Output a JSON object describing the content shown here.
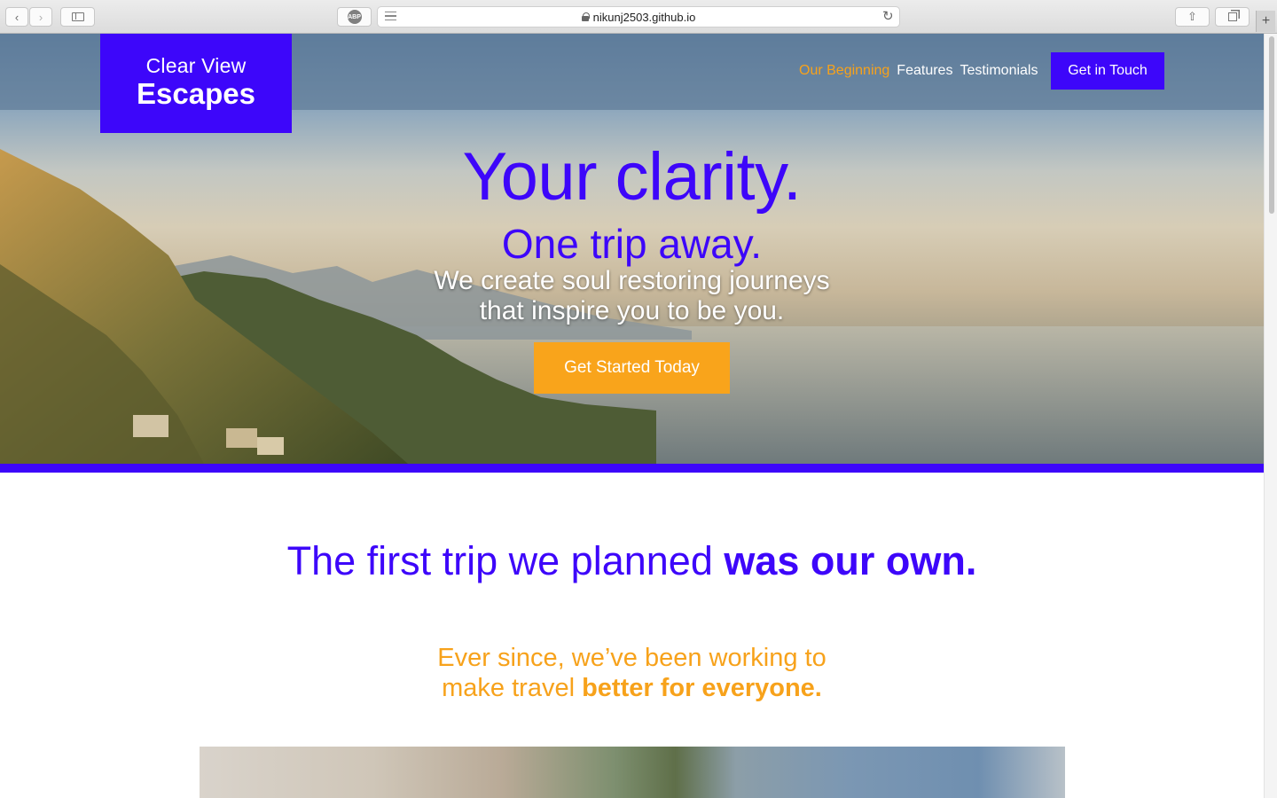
{
  "browser": {
    "url": "nikunj2503.github.io",
    "adblock_label": "ABP"
  },
  "brand": {
    "line1": "Clear View",
    "line2": "Escapes"
  },
  "nav": {
    "items": [
      {
        "label": "Our Beginning",
        "active": true
      },
      {
        "label": "Features",
        "active": false
      },
      {
        "label": "Testimonials",
        "active": false
      }
    ],
    "cta_label": "Get in Touch"
  },
  "hero": {
    "title": "Your clarity.",
    "subtitle": "One trip away.",
    "tagline_line1": "We create soul restoring journeys",
    "tagline_line2": "that inspire you to be you.",
    "button_label": "Get Started Today"
  },
  "intro": {
    "title_regular": "The first trip we planned ",
    "title_bold": "was our own.",
    "sub_line1": "Ever since, we’ve been working to",
    "sub_line2_regular": "make travel ",
    "sub_line2_bold": "better for everyone."
  },
  "colors": {
    "brand_purple": "#3d06fa",
    "accent_orange": "#f9a41b"
  }
}
